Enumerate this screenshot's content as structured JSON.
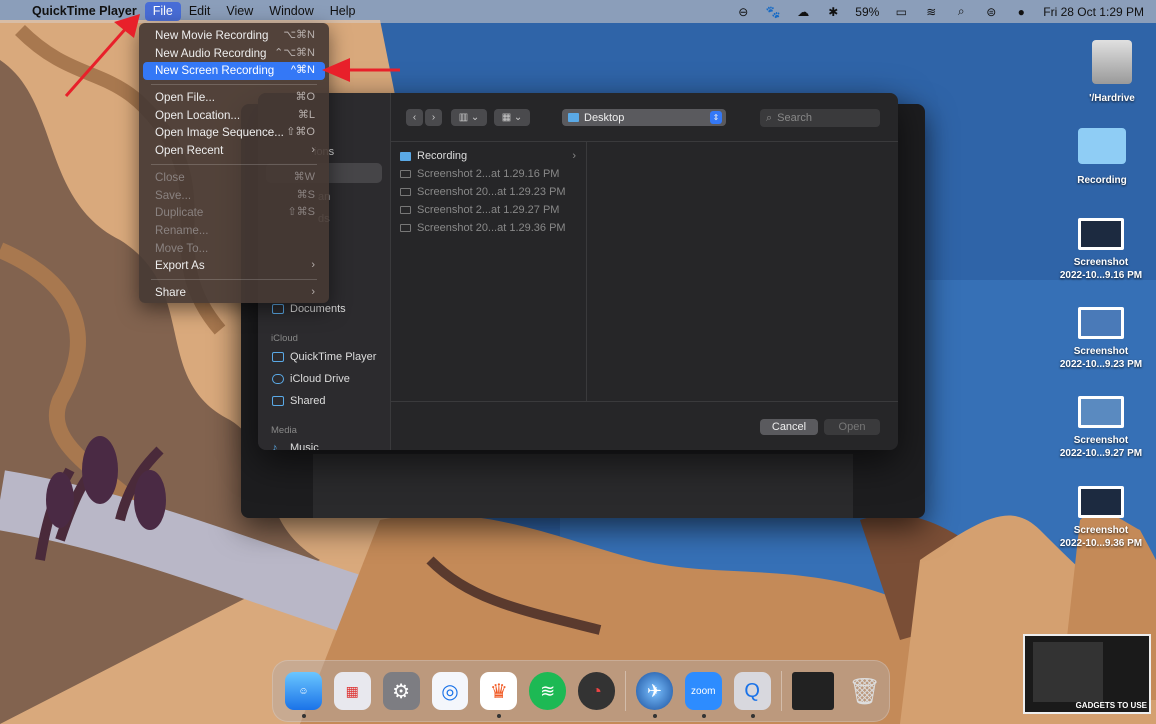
{
  "menubar": {
    "app_name": "QuickTime Player",
    "menus": [
      "File",
      "Edit",
      "View",
      "Window",
      "Help"
    ],
    "battery": "59%",
    "datetime": "Fri 28 Oct  1:29 PM"
  },
  "file_menu": {
    "items": [
      {
        "label": "New Movie Recording",
        "shortcut": "⌥⌘N"
      },
      {
        "label": "New Audio Recording",
        "shortcut": "⌃⌥⌘N"
      },
      {
        "label": "New Screen Recording",
        "shortcut": "^⌘N"
      },
      {
        "label": "Open File...",
        "shortcut": "⌘O"
      },
      {
        "label": "Open Location...",
        "shortcut": "⌘L"
      },
      {
        "label": "Open Image Sequence...",
        "shortcut": "⇧⌘O"
      },
      {
        "label": "Open Recent",
        "shortcut": "›"
      },
      {
        "label": "Close",
        "shortcut": "⌘W"
      },
      {
        "label": "Save...",
        "shortcut": "⌘S"
      },
      {
        "label": "Duplicate",
        "shortcut": "⇧⌘S"
      },
      {
        "label": "Rename...",
        "shortcut": ""
      },
      {
        "label": "Move To...",
        "shortcut": ""
      },
      {
        "label": "Export As",
        "shortcut": "›"
      },
      {
        "label": "Share",
        "shortcut": "›"
      }
    ]
  },
  "open_dialog": {
    "location": "Desktop",
    "search_placeholder": "Search",
    "sidebar": {
      "partial_items": [
        "ions",
        "an",
        "ds"
      ],
      "documents": "Documents",
      "icloud_header": "iCloud",
      "icloud_items": [
        "QuickTime Player",
        "iCloud Drive",
        "Shared"
      ],
      "media_header": "Media",
      "media_items": [
        "Music"
      ]
    },
    "files": [
      {
        "name": "Recording"
      },
      {
        "name": "Screenshot 2...at 1.29.16 PM"
      },
      {
        "name": "Screenshot 20...at 1.29.23 PM"
      },
      {
        "name": "Screenshot 2...at 1.29.27 PM"
      },
      {
        "name": "Screenshot 20...at 1.29.36 PM"
      }
    ],
    "cancel": "Cancel",
    "open": "Open"
  },
  "desktop_icons": [
    {
      "label": "'/Hardrive"
    },
    {
      "label": "Recording"
    },
    {
      "label1": "Screenshot",
      "label2": "2022-10...9.16 PM"
    },
    {
      "label1": "Screenshot",
      "label2": "2022-10...9.23 PM"
    },
    {
      "label1": "Screenshot",
      "label2": "2022-10...9.27 PM"
    },
    {
      "label1": "Screenshot",
      "label2": "2022-10...9.36 PM"
    }
  ],
  "dock": {
    "zoom_label": "zoom"
  },
  "watermark": "GADGETS TO USE",
  "colors": {
    "menu_highlight": "#3478f6",
    "annotation_arrow": "#e8202a"
  }
}
